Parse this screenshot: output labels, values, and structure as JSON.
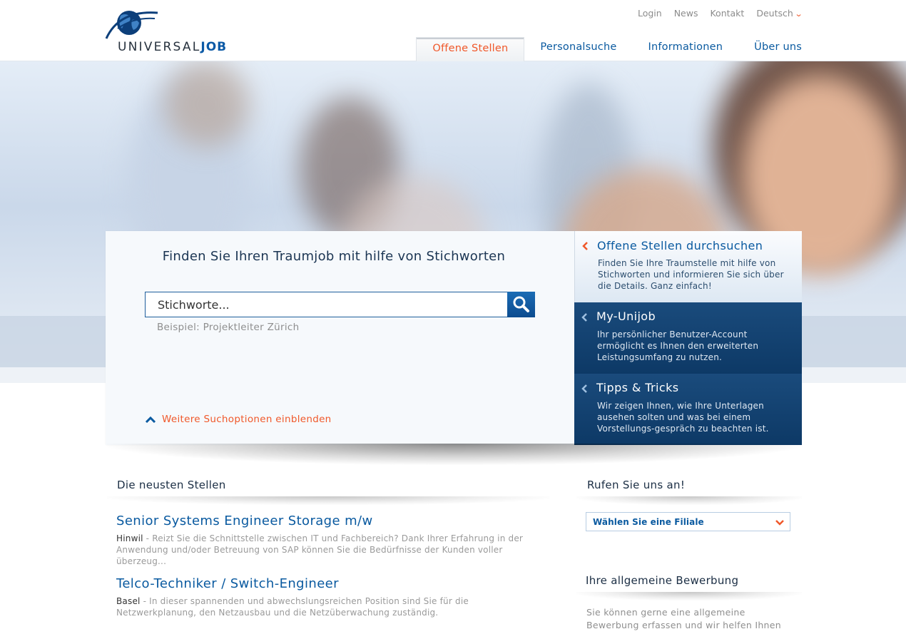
{
  "brand": {
    "logo_text_light": "UNIVERSAL",
    "logo_text_bold": "JOB"
  },
  "topnav": {
    "login": "Login",
    "news": "News",
    "contact": "Kontakt",
    "language": "Deutsch"
  },
  "mainnav": [
    {
      "label": "Offene Stellen",
      "active": true
    },
    {
      "label": "Personalsuche"
    },
    {
      "label": "Informationen"
    },
    {
      "label": "Über uns"
    }
  ],
  "search": {
    "title": "Finden Sie Ihren Traumjob mit hilfe von Stichworten",
    "placeholder": "Stichworte...",
    "hint": "Beispiel: Projektleiter Zürich",
    "more_options": "Weitere Suchoptionen einblenden"
  },
  "side_tabs": [
    {
      "title": "Offene Stellen durchsuchen",
      "text": "Finden Sie Ihre Traumstelle mit hilfe von Stichworten und informieren Sie sich über die Details. Ganz einfach!"
    },
    {
      "title": "My-Unijob",
      "text": "Ihr persönlicher Benutzer-Account ermöglicht es Ihnen den erweiterten Leistungsumfang zu nutzen."
    },
    {
      "title": "Tipps & Tricks",
      "text": "Wir zeigen Ihnen, wie Ihre Unterlagen ausehen solten und was bei einem Vorstellungs-gespräch zu beachten ist."
    }
  ],
  "latest": {
    "heading": "Die neusten Stellen",
    "jobs": [
      {
        "title": "Senior Systems Engineer Storage m/w",
        "location": "Hinwil",
        "text": " - Reizt Sie die Schnittstelle zwischen IT und Fachbereich? Dank Ihrer Erfahrung in der Anwendung und/oder Betreuung von SAP können Sie die Bedürfnisse der Kunden voller überzeug..."
      },
      {
        "title": "Telco-Techniker / Switch-Engineer",
        "location": "Basel",
        "text": " - In dieser spannenden und abwechslungsreichen Position sind Sie für die Netzwerkplanung, den Netzausbau und die Netzüberwachung zuständig."
      }
    ]
  },
  "call": {
    "heading": "Rufen Sie uns an!",
    "select_label": "Wählen Sie eine Filiale"
  },
  "application": {
    "heading": "Ihre allgemeine Bewerbung",
    "text": "Sie können gerne eine allgemeine Bewerbung erfassen und wir helfen Ihnen eine geeignete"
  },
  "colors": {
    "accent_orange": "#f0582a",
    "brand_blue": "#0a5aa0",
    "dark_blue": "#0d3966"
  }
}
